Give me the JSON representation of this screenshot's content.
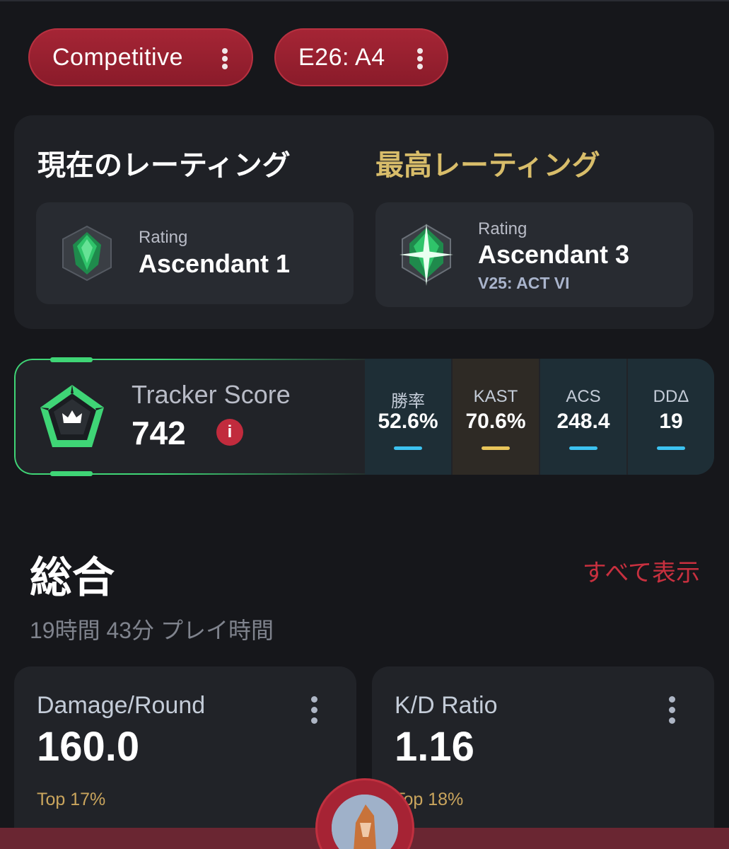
{
  "filters": {
    "mode": "Competitive",
    "season": "E26: A4"
  },
  "ratings": {
    "current_heading": "現在のレーティング",
    "peak_heading": "最高レーティング",
    "current": {
      "label": "Rating",
      "rank": "Ascendant 1"
    },
    "peak": {
      "label": "Rating",
      "rank": "Ascendant 3",
      "act": "V25: ACT VI"
    }
  },
  "tracker": {
    "label": "Tracker Score",
    "value": "742",
    "info_icon": "i",
    "stats": [
      {
        "label": "勝率",
        "value": "52.6%",
        "accent": "#3cc2f0"
      },
      {
        "label": "KAST",
        "value": "70.6%",
        "accent": "#e9c55a"
      },
      {
        "label": "ACS",
        "value": "248.4",
        "accent": "#3cc2f0"
      },
      {
        "label": "DDΔ",
        "value": "19",
        "accent": "#3cc2f0"
      }
    ]
  },
  "overview": {
    "title": "総合",
    "view_all": "すべて表示",
    "playtime": "19時間 43分 プレイ時間",
    "cards": [
      {
        "label": "Damage/Round",
        "value": "160.0",
        "top": "Top 17%"
      },
      {
        "label": "K/D Ratio",
        "value": "1.16",
        "top": "Top 18%"
      }
    ]
  },
  "colors": {
    "accent_red": "#a52535",
    "peak_gold": "#d8bd6a",
    "tracker_green": "#3fd576"
  }
}
